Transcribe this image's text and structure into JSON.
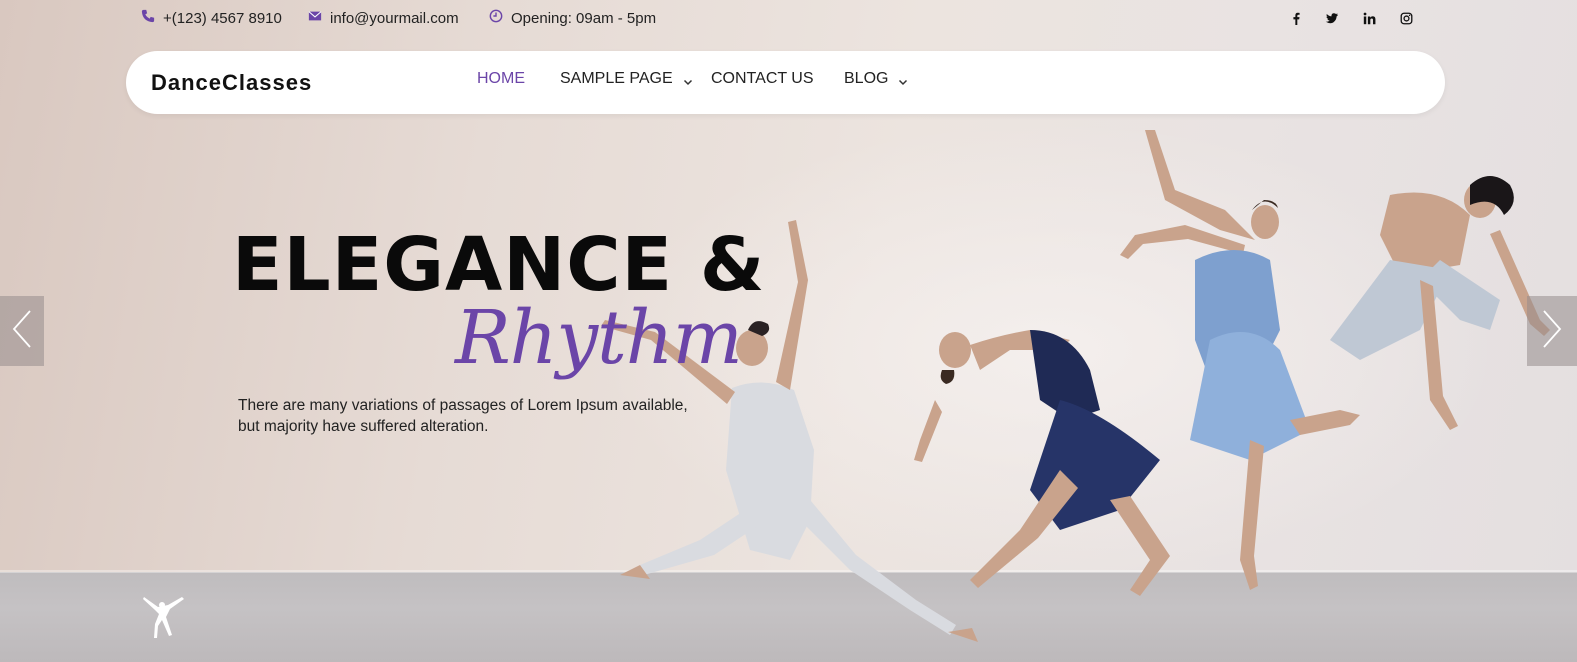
{
  "topbar": {
    "phone": "+(123) 4567 8910",
    "email": "info@yourmail.com",
    "hours": "Opening: 09am - 5pm",
    "social_icons": [
      "facebook-icon",
      "twitter-icon",
      "linkedin-icon",
      "instagram-icon"
    ]
  },
  "nav": {
    "logo": "DanceClasses",
    "items": [
      {
        "label": "HOME",
        "active": true,
        "has_dropdown": false
      },
      {
        "label": "SAMPLE PAGE",
        "active": false,
        "has_dropdown": true
      },
      {
        "label": "CONTACT US",
        "active": false,
        "has_dropdown": false
      },
      {
        "label": "BLOG",
        "active": false,
        "has_dropdown": true
      }
    ]
  },
  "hero": {
    "title": "ELEGANCE &",
    "script": "Rhythm",
    "description_line1": "There are many variations of passages of Lorem Ipsum available,",
    "description_line2": "but majority have suffered alteration."
  },
  "colors": {
    "accent": "#6b45a8",
    "text": "#0a0a0a",
    "navbar_bg": "#ffffff"
  }
}
